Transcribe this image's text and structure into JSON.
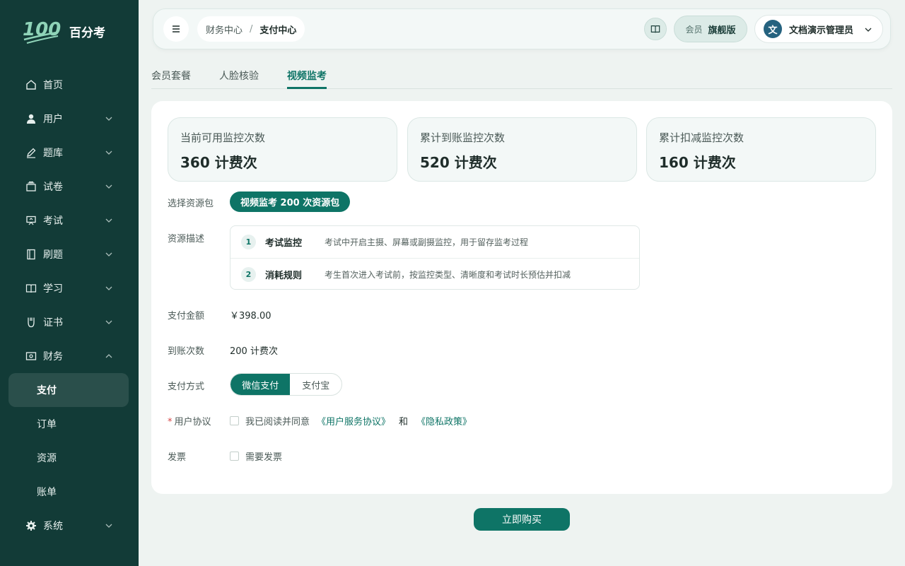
{
  "app": {
    "logo_text": "100",
    "name": "百分考"
  },
  "sidebar": {
    "items": [
      {
        "label": "首页",
        "icon": "home-icon"
      },
      {
        "label": "用户",
        "icon": "user-icon"
      },
      {
        "label": "题库",
        "icon": "edit-icon"
      },
      {
        "label": "试卷",
        "icon": "layers-icon"
      },
      {
        "label": "考试",
        "icon": "presentation-icon"
      },
      {
        "label": "刷题",
        "icon": "notebook-icon"
      },
      {
        "label": "学习",
        "icon": "book-open-icon"
      },
      {
        "label": "证书",
        "icon": "badge-icon"
      },
      {
        "label": "财务",
        "icon": "wallet-icon",
        "expanded": true
      },
      {
        "label": "系统",
        "icon": "gear-icon"
      }
    ],
    "finance_sub": [
      {
        "label": "支付",
        "active": true
      },
      {
        "label": "订单"
      },
      {
        "label": "资源"
      },
      {
        "label": "账单"
      }
    ]
  },
  "header": {
    "breadcrumb": [
      "财务中心",
      "支付中心"
    ],
    "breadcrumb_sep": "/",
    "member_label": "会员",
    "member_tier": "旗舰版",
    "user_initial": "文",
    "user_name": "文档演示管理员"
  },
  "tabs": [
    {
      "label": "会员套餐",
      "active": false
    },
    {
      "label": "人脸核验",
      "active": false
    },
    {
      "label": "视频监考",
      "active": true
    }
  ],
  "stats": [
    {
      "label": "当前可用监控次数",
      "value": "360 计费次"
    },
    {
      "label": "累计到账监控次数",
      "value": "520 计费次"
    },
    {
      "label": "累计扣减监控次数",
      "value": "160 计费次"
    }
  ],
  "form": {
    "package_label": "选择资源包",
    "package_value": "视频监考 200 次资源包",
    "desc_label": "资源描述",
    "desc_rows": [
      {
        "num": "1",
        "title": "考试监控",
        "text": "考试中开启主摄、屏幕或副摄监控，用于留存监考过程"
      },
      {
        "num": "2",
        "title": "消耗规则",
        "text": "考生首次进入考试前，按监控类型、清晰度和考试时长预估并扣减"
      }
    ],
    "amount_label": "支付金额",
    "amount_value": "￥398.00",
    "count_label": "到账次数",
    "count_value": "200 计费次",
    "method_label": "支付方式",
    "methods": [
      "微信支付",
      "支付宝"
    ],
    "selected_method": "微信支付",
    "agreement_required": "*",
    "agreement_label": "用户协议",
    "agreement_text": "我已阅读并同意",
    "agreement_link1": "《用户服务协议》",
    "agreement_and": "和",
    "agreement_link2": "《隐私政策》",
    "invoice_label": "发票",
    "invoice_text": "需要发票"
  },
  "buy_button": "立即购买",
  "colors": {
    "sidebar_bg": "#123b37",
    "accent": "#0e7466",
    "page_bg": "#eef3f1"
  }
}
